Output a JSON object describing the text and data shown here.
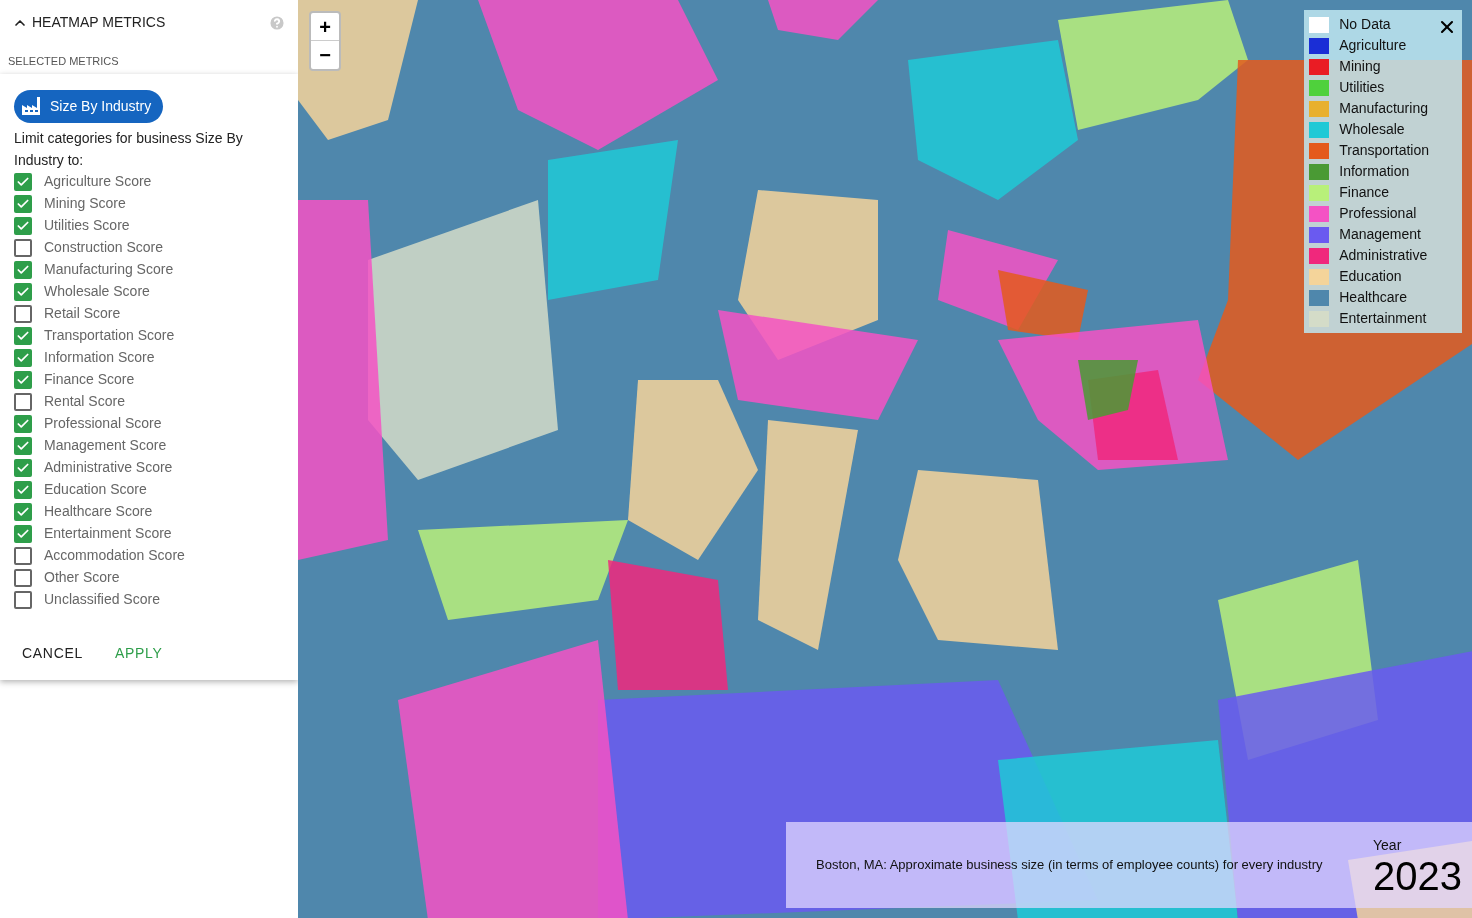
{
  "panel": {
    "title": "HEATMAP METRICS",
    "expanded": true,
    "section_label": "SELECTED METRICS",
    "metric_button": "Size By Industry",
    "instructions": "Limit categories for business Size By Industry to:",
    "categories": [
      {
        "label": "Agriculture Score",
        "checked": true
      },
      {
        "label": "Mining Score",
        "checked": true
      },
      {
        "label": "Utilities Score",
        "checked": true
      },
      {
        "label": "Construction Score",
        "checked": false
      },
      {
        "label": "Manufacturing Score",
        "checked": true
      },
      {
        "label": "Wholesale Score",
        "checked": true
      },
      {
        "label": "Retail Score",
        "checked": false
      },
      {
        "label": "Transportation Score",
        "checked": true
      },
      {
        "label": "Information Score",
        "checked": true
      },
      {
        "label": "Finance Score",
        "checked": true
      },
      {
        "label": "Rental Score",
        "checked": false
      },
      {
        "label": "Professional Score",
        "checked": true
      },
      {
        "label": "Management Score",
        "checked": true
      },
      {
        "label": "Administrative Score",
        "checked": true
      },
      {
        "label": "Education Score",
        "checked": true
      },
      {
        "label": "Healthcare Score",
        "checked": true
      },
      {
        "label": "Entertainment Score",
        "checked": true
      },
      {
        "label": "Accommodation Score",
        "checked": false
      },
      {
        "label": "Other Score",
        "checked": false
      },
      {
        "label": "Unclassified Score",
        "checked": false
      }
    ],
    "buttons": [
      "CANCEL",
      "APPLY"
    ]
  },
  "map": {
    "zoom_in": "+",
    "zoom_out": "−",
    "legend": [
      {
        "label": "No Data",
        "color": "#ffffff"
      },
      {
        "label": "Agriculture",
        "color": "#1a2ed6"
      },
      {
        "label": "Mining",
        "color": "#ea1c24"
      },
      {
        "label": "Utilities",
        "color": "#4fd13c"
      },
      {
        "label": "Manufacturing",
        "color": "#e8b02e"
      },
      {
        "label": "Wholesale",
        "color": "#1fc9d6"
      },
      {
        "label": "Transportation",
        "color": "#e45a1c"
      },
      {
        "label": "Information",
        "color": "#4a9a34"
      },
      {
        "label": "Finance",
        "color": "#b8f07a"
      },
      {
        "label": "Professional",
        "color": "#f452c4"
      },
      {
        "label": "Management",
        "color": "#6a5af0"
      },
      {
        "label": "Administrative",
        "color": "#f0287c"
      },
      {
        "label": "Education",
        "color": "#f4d49a"
      },
      {
        "label": "Healthcare",
        "color": "#4f87ac"
      },
      {
        "label": "Entertainment",
        "color": "#d4dcc8"
      }
    ],
    "caption": "Boston, MA: Approximate business size (in terms of employee counts) for every industry",
    "year_label": "Year",
    "year": "2023"
  }
}
